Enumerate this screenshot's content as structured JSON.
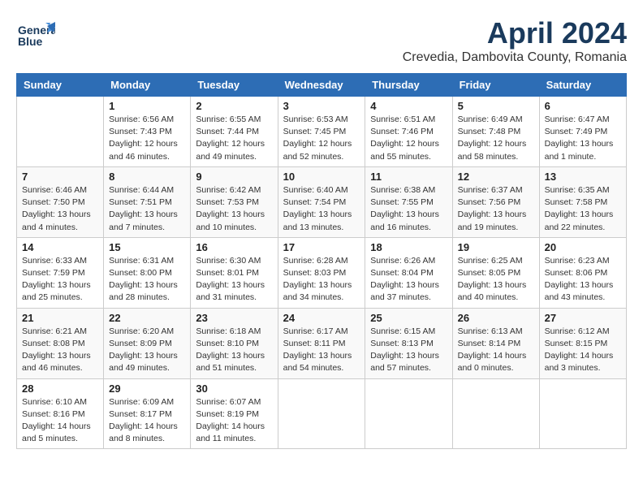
{
  "header": {
    "logo_line1": "General",
    "logo_line2": "Blue",
    "month": "April 2024",
    "location": "Crevedia, Dambovita County, Romania"
  },
  "weekdays": [
    "Sunday",
    "Monday",
    "Tuesday",
    "Wednesday",
    "Thursday",
    "Friday",
    "Saturday"
  ],
  "weeks": [
    [
      {
        "day": "",
        "info": ""
      },
      {
        "day": "1",
        "info": "Sunrise: 6:56 AM\nSunset: 7:43 PM\nDaylight: 12 hours\nand 46 minutes."
      },
      {
        "day": "2",
        "info": "Sunrise: 6:55 AM\nSunset: 7:44 PM\nDaylight: 12 hours\nand 49 minutes."
      },
      {
        "day": "3",
        "info": "Sunrise: 6:53 AM\nSunset: 7:45 PM\nDaylight: 12 hours\nand 52 minutes."
      },
      {
        "day": "4",
        "info": "Sunrise: 6:51 AM\nSunset: 7:46 PM\nDaylight: 12 hours\nand 55 minutes."
      },
      {
        "day": "5",
        "info": "Sunrise: 6:49 AM\nSunset: 7:48 PM\nDaylight: 12 hours\nand 58 minutes."
      },
      {
        "day": "6",
        "info": "Sunrise: 6:47 AM\nSunset: 7:49 PM\nDaylight: 13 hours\nand 1 minute."
      }
    ],
    [
      {
        "day": "7",
        "info": "Sunrise: 6:46 AM\nSunset: 7:50 PM\nDaylight: 13 hours\nand 4 minutes."
      },
      {
        "day": "8",
        "info": "Sunrise: 6:44 AM\nSunset: 7:51 PM\nDaylight: 13 hours\nand 7 minutes."
      },
      {
        "day": "9",
        "info": "Sunrise: 6:42 AM\nSunset: 7:53 PM\nDaylight: 13 hours\nand 10 minutes."
      },
      {
        "day": "10",
        "info": "Sunrise: 6:40 AM\nSunset: 7:54 PM\nDaylight: 13 hours\nand 13 minutes."
      },
      {
        "day": "11",
        "info": "Sunrise: 6:38 AM\nSunset: 7:55 PM\nDaylight: 13 hours\nand 16 minutes."
      },
      {
        "day": "12",
        "info": "Sunrise: 6:37 AM\nSunset: 7:56 PM\nDaylight: 13 hours\nand 19 minutes."
      },
      {
        "day": "13",
        "info": "Sunrise: 6:35 AM\nSunset: 7:58 PM\nDaylight: 13 hours\nand 22 minutes."
      }
    ],
    [
      {
        "day": "14",
        "info": "Sunrise: 6:33 AM\nSunset: 7:59 PM\nDaylight: 13 hours\nand 25 minutes."
      },
      {
        "day": "15",
        "info": "Sunrise: 6:31 AM\nSunset: 8:00 PM\nDaylight: 13 hours\nand 28 minutes."
      },
      {
        "day": "16",
        "info": "Sunrise: 6:30 AM\nSunset: 8:01 PM\nDaylight: 13 hours\nand 31 minutes."
      },
      {
        "day": "17",
        "info": "Sunrise: 6:28 AM\nSunset: 8:03 PM\nDaylight: 13 hours\nand 34 minutes."
      },
      {
        "day": "18",
        "info": "Sunrise: 6:26 AM\nSunset: 8:04 PM\nDaylight: 13 hours\nand 37 minutes."
      },
      {
        "day": "19",
        "info": "Sunrise: 6:25 AM\nSunset: 8:05 PM\nDaylight: 13 hours\nand 40 minutes."
      },
      {
        "day": "20",
        "info": "Sunrise: 6:23 AM\nSunset: 8:06 PM\nDaylight: 13 hours\nand 43 minutes."
      }
    ],
    [
      {
        "day": "21",
        "info": "Sunrise: 6:21 AM\nSunset: 8:08 PM\nDaylight: 13 hours\nand 46 minutes."
      },
      {
        "day": "22",
        "info": "Sunrise: 6:20 AM\nSunset: 8:09 PM\nDaylight: 13 hours\nand 49 minutes."
      },
      {
        "day": "23",
        "info": "Sunrise: 6:18 AM\nSunset: 8:10 PM\nDaylight: 13 hours\nand 51 minutes."
      },
      {
        "day": "24",
        "info": "Sunrise: 6:17 AM\nSunset: 8:11 PM\nDaylight: 13 hours\nand 54 minutes."
      },
      {
        "day": "25",
        "info": "Sunrise: 6:15 AM\nSunset: 8:13 PM\nDaylight: 13 hours\nand 57 minutes."
      },
      {
        "day": "26",
        "info": "Sunrise: 6:13 AM\nSunset: 8:14 PM\nDaylight: 14 hours\nand 0 minutes."
      },
      {
        "day": "27",
        "info": "Sunrise: 6:12 AM\nSunset: 8:15 PM\nDaylight: 14 hours\nand 3 minutes."
      }
    ],
    [
      {
        "day": "28",
        "info": "Sunrise: 6:10 AM\nSunset: 8:16 PM\nDaylight: 14 hours\nand 5 minutes."
      },
      {
        "day": "29",
        "info": "Sunrise: 6:09 AM\nSunset: 8:17 PM\nDaylight: 14 hours\nand 8 minutes."
      },
      {
        "day": "30",
        "info": "Sunrise: 6:07 AM\nSunset: 8:19 PM\nDaylight: 14 hours\nand 11 minutes."
      },
      {
        "day": "",
        "info": ""
      },
      {
        "day": "",
        "info": ""
      },
      {
        "day": "",
        "info": ""
      },
      {
        "day": "",
        "info": ""
      }
    ]
  ]
}
